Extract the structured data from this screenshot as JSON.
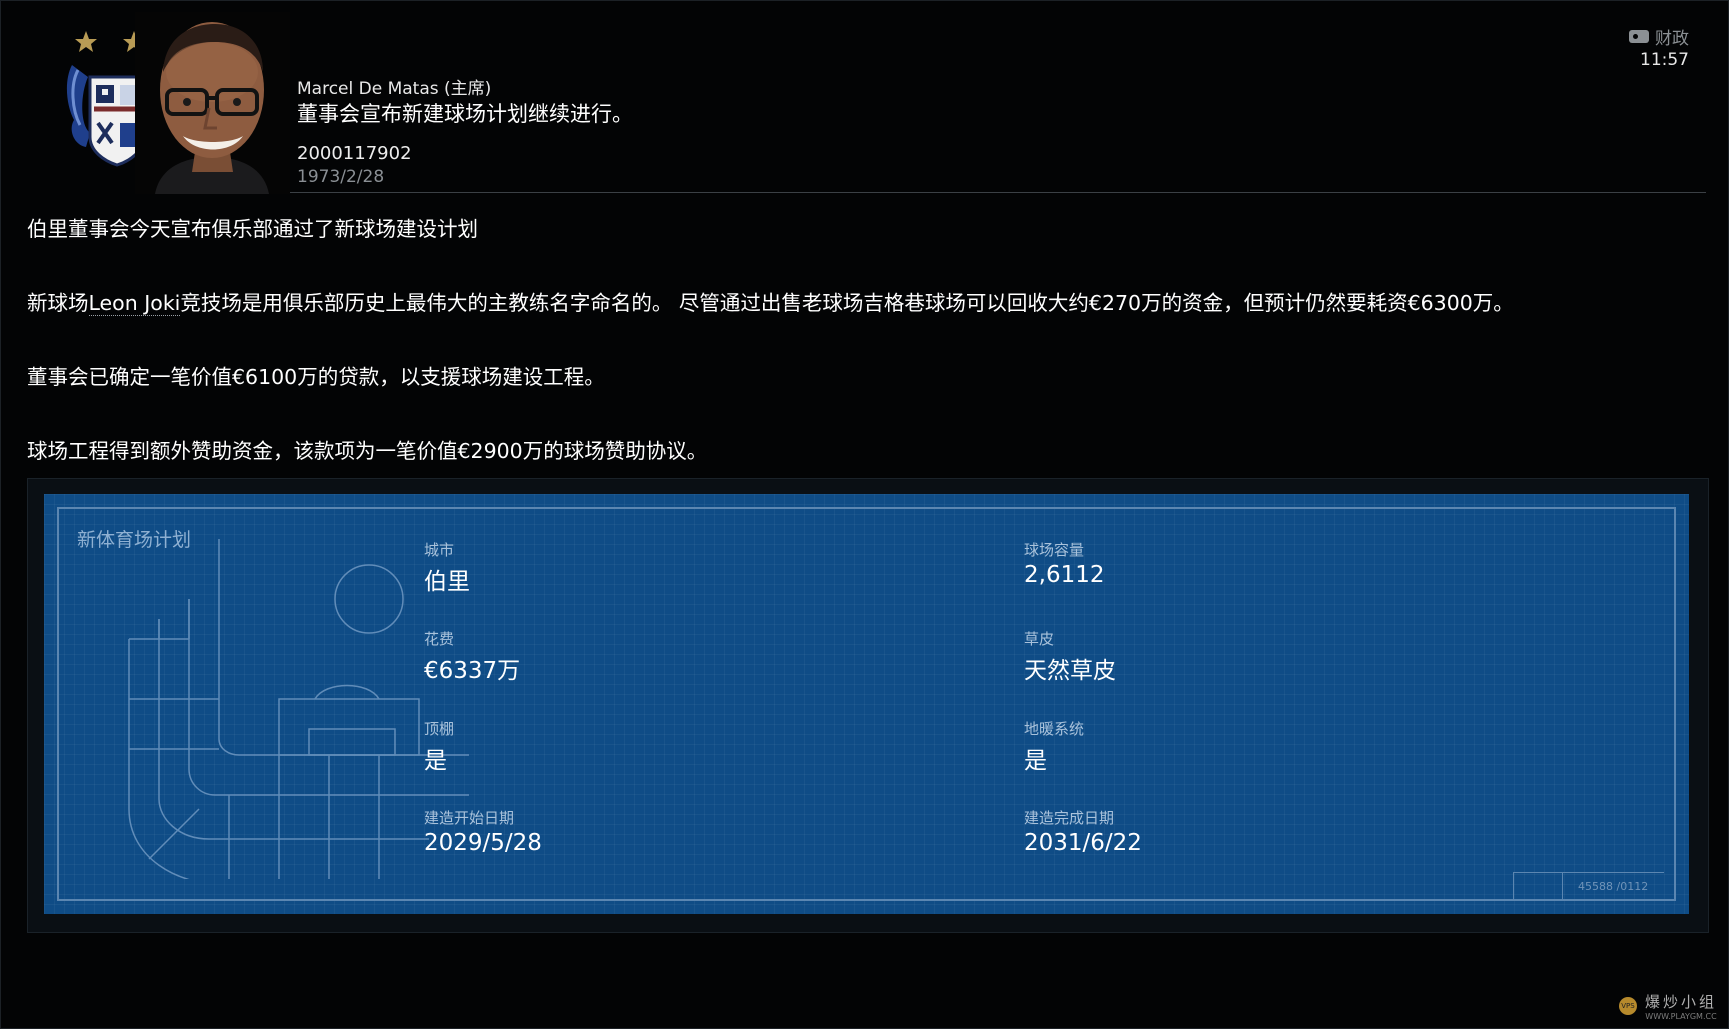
{
  "header": {
    "sender": "Marcel De Matas (主席)",
    "subject": "董事会宣布新建球场计划继续进行。",
    "id_number": "2000117902",
    "date": "1973/2/28",
    "category": "财政",
    "time": "11:57"
  },
  "body": {
    "para1": "伯里董事会今天宣布俱乐部通过了新球场建设计划",
    "para2_prefix": "新球场",
    "para2_link": "Leon Joki",
    "para2_suffix": "竞技场是用俱乐部历史上最伟大的主教练名字命名的。 尽管通过出售老球场吉格巷球场可以回收大约€270万的资金，但预计仍然要耗资€6300万。",
    "para3": "董事会已确定一笔价值€6100万的贷款，以支援球场建设工程。",
    "para4": "球场工程得到额外赞助资金，该款项为一笔价值€2900万的球场赞助协议。"
  },
  "stadium_plan": {
    "title": "新体育场计划",
    "city_label": "城市",
    "city_value": "伯里",
    "capacity_label": "球场容量",
    "capacity_value": "2,6112",
    "cost_label": "花费",
    "cost_value": "€6337万",
    "pitch_label": "草皮",
    "pitch_value": "天然草皮",
    "roof_label": "顶棚",
    "roof_value": "是",
    "heating_label": "地暖系统",
    "heating_value": "是",
    "start_label": "建造开始日期",
    "start_value": "2029/5/28",
    "end_label": "建造完成日期",
    "end_value": "2031/6/22",
    "drawing_code": "45588 /0112"
  },
  "watermark": {
    "text": "爆炒小组",
    "url": "WWW.PLAYGM.CC",
    "badge": "VPS"
  },
  "colors": {
    "background": "#030405",
    "blueprint": "#0f4c86",
    "blueprint_line": "#5b86b1"
  }
}
